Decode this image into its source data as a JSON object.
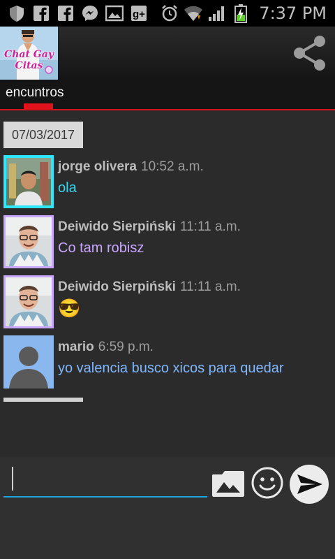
{
  "status_bar": {
    "time": "7:37 PM",
    "icons": [
      "shield-icon",
      "facebook-icon",
      "facebook-icon",
      "messenger-icon",
      "image-icon",
      "google-plus-icon",
      "alarm-icon",
      "wifi-icon",
      "signal-icon",
      "battery-charging-icon"
    ]
  },
  "app_bar": {
    "logo_text": "Chat Gay Citas",
    "share_icon": "share-icon"
  },
  "tabs": [
    {
      "label": "encuntros"
    }
  ],
  "colors": {
    "accent_red": "#e0121b",
    "accent_blue": "#1fa6dc",
    "text_cyan": "#33d7f0",
    "text_purple": "#c8a6ff",
    "text_blue": "#7fb7ff"
  },
  "chat": {
    "date": "07/03/2017",
    "messages": [
      {
        "name": "jorge olivera",
        "time": "10:52 a.m.",
        "text": "ola"
      },
      {
        "name": "Deiwido Sierpiński",
        "time": "11:11 a.m.",
        "text": "Co tam robisz"
      },
      {
        "name": "Deiwido Sierpiński",
        "time": "11:11 a.m.",
        "text": "😎"
      },
      {
        "name": "mario",
        "time": "6:59 p.m.",
        "text": "yo valencia busco xicos para quedar"
      }
    ]
  },
  "composer": {
    "input_value": "",
    "icons": [
      "image-attach-icon",
      "emoji-icon",
      "send-icon"
    ]
  }
}
